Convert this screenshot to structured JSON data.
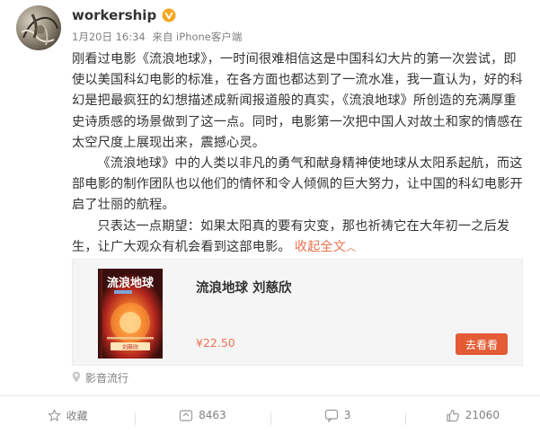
{
  "post": {
    "username": "workership",
    "verified_icon": "vip-v-icon",
    "timestamp": "1月20日 16:34",
    "source": "来自 iPhone客户端",
    "paragraphs": [
      "刚看过电影《流浪地球》，一时间很难相信这是中国科幻大片的第一次尝试，即使以美国科幻电影的标准，在各方面也都达到了一流水准，我一直认为，好的科幻是把最疯狂的幻想描述成新闻报道般的真实，《流浪地球》所创造的充满厚重史诗质感的场景做到了这一点。同时，电影第一次把中国人对故土和家的情感在太空尺度上展现出来，震撼心灵。",
      "《流浪地球》中的人类以非凡的勇气和献身精神使地球从太阳系起航，而这部电影的制作团队也以他们的情怀和令人倾佩的巨大努力，让中国的科幻电影开启了壮丽的航程。",
      "只表达一点期望：如果太阳真的要有灾变，那也祈祷它在大年初一之后发生，让广大观众有机会看到这部电影。"
    ],
    "collapse_label": "收起全文",
    "collapse_icon": "chevron-up-icon"
  },
  "card": {
    "title": "流浪地球 刘慈欣",
    "price": "¥22.50",
    "button": "去看看",
    "book_title": "流浪地球",
    "book_author": "刘慈欣"
  },
  "attribution": {
    "label": "影音流行",
    "icon": "location-pin-icon"
  },
  "actions": {
    "favorite": "收藏",
    "repost": "8463",
    "comment": "3",
    "like": "21060"
  },
  "colors": {
    "accent": "#eb7350",
    "button": "#e35c36",
    "text": "#333333",
    "muted": "#808080"
  }
}
